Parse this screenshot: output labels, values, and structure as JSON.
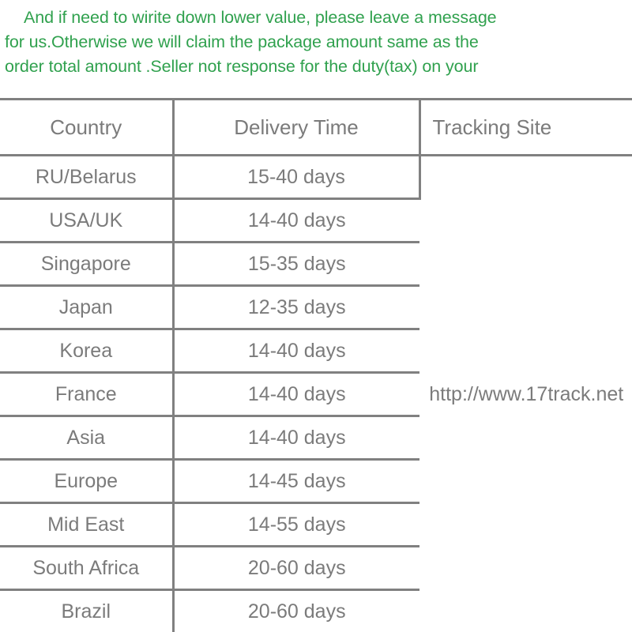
{
  "notice": {
    "lines": [
      "And if need to wirite down lower value, please leave a message",
      "for us.Otherwise we will claim the package amount same as the",
      "order total amount .Seller not response for the duty(tax) on your"
    ],
    "color": "#30a14e"
  },
  "table": {
    "border_color": "#808080",
    "text_color": "#7b7b7b",
    "headers": [
      "Country",
      "Delivery Time",
      "Tracking Site"
    ],
    "tracking_site": "http://www.17track.net",
    "rows": [
      {
        "country": "RU/Belarus",
        "delivery_time": "15-40 days"
      },
      {
        "country": "USA/UK",
        "delivery_time": "14-40 days"
      },
      {
        "country": "Singapore",
        "delivery_time": "15-35 days"
      },
      {
        "country": "Japan",
        "delivery_time": "12-35 days"
      },
      {
        "country": "Korea",
        "delivery_time": "14-40 days"
      },
      {
        "country": "France",
        "delivery_time": "14-40 days"
      },
      {
        "country": "Asia",
        "delivery_time": "14-40 days"
      },
      {
        "country": "Europe",
        "delivery_time": "14-45 days"
      },
      {
        "country": "Mid East",
        "delivery_time": "14-55 days"
      },
      {
        "country": "South Africa",
        "delivery_time": "20-60 days"
      },
      {
        "country": "Brazil",
        "delivery_time": "20-60 days"
      }
    ]
  }
}
